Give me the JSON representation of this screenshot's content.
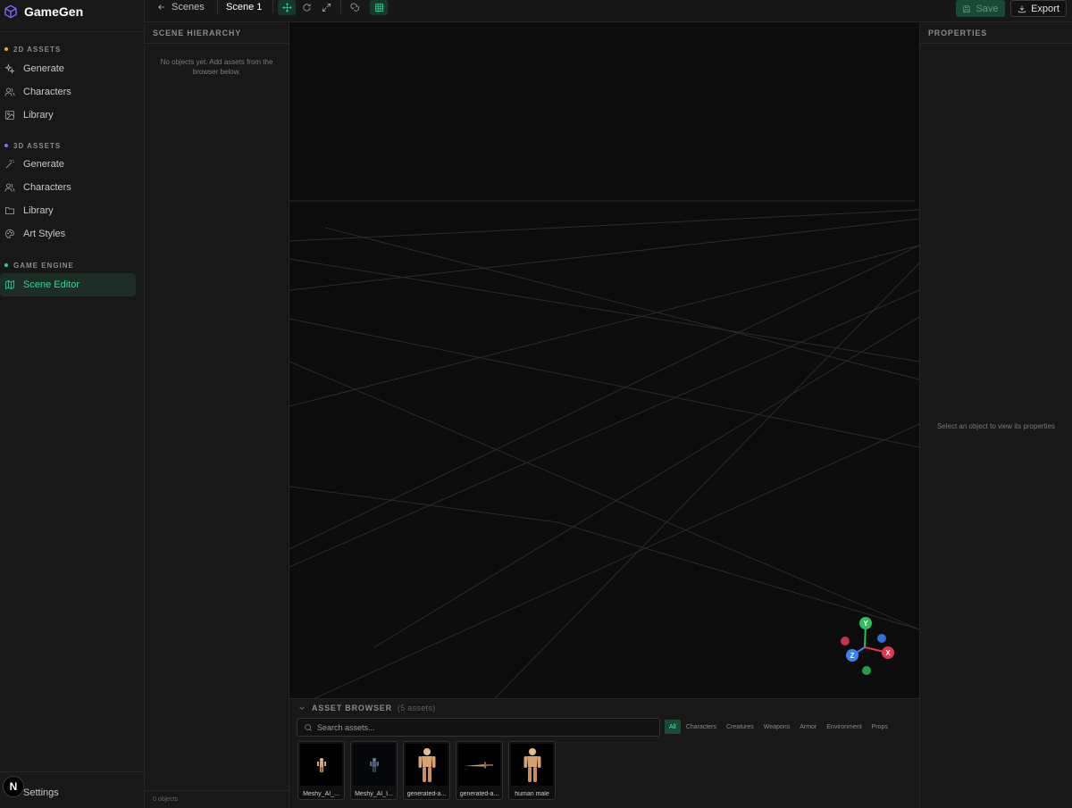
{
  "app": {
    "name": "GameGen"
  },
  "sidebar": {
    "sections": [
      {
        "title": "2D ASSETS",
        "dot_color": "#f5a623",
        "items": [
          {
            "label": "Generate",
            "icon": "sparkles-icon"
          },
          {
            "label": "Characters",
            "icon": "users-icon"
          },
          {
            "label": "Library",
            "icon": "image-icon"
          }
        ]
      },
      {
        "title": "3D ASSETS",
        "dot_color": "#6b7cff",
        "items": [
          {
            "label": "Generate",
            "icon": "magic-wand-icon"
          },
          {
            "label": "Characters",
            "icon": "users-icon"
          },
          {
            "label": "Library",
            "icon": "folder-icon"
          },
          {
            "label": "Art Styles",
            "icon": "palette-icon"
          }
        ]
      },
      {
        "title": "GAME ENGINE",
        "dot_color": "#2fd08f",
        "items": [
          {
            "label": "Scene Editor",
            "icon": "map-icon",
            "active": true
          }
        ]
      }
    ],
    "settings_label": "Settings",
    "avatar_letter": "N"
  },
  "topbar": {
    "back_label": "Scenes",
    "scene_name": "Scene 1",
    "tools": [
      {
        "icon": "move-icon",
        "active": true
      },
      {
        "icon": "rotate-icon",
        "active": false
      },
      {
        "icon": "scale-icon",
        "active": false
      },
      {
        "icon": "magnet-icon",
        "active": false
      },
      {
        "icon": "grid-icon",
        "active": true
      }
    ],
    "save_label": "Save",
    "export_label": "Export"
  },
  "hierarchy": {
    "title": "SCENE HIERARCHY",
    "empty_message": "No objects yet. Add assets from the browser below.",
    "object_count": "0 objects"
  },
  "properties": {
    "title": "PROPERTIES",
    "empty_message": "Select an object to view its properties"
  },
  "gizmo": {
    "x_label": "X",
    "y_label": "Y",
    "z_label": "Z"
  },
  "asset_browser": {
    "title": "ASSET BROWSER",
    "count": "(5 assets)",
    "search_placeholder": "Search assets...",
    "filters": [
      "All",
      "Characters",
      "Creatures",
      "Weapons",
      "Armor",
      "Environment",
      "Props"
    ],
    "active_filter": "All",
    "assets": [
      {
        "name": "Meshy_AI_...",
        "thumb": "small-figure"
      },
      {
        "name": "Meshy_AI_I...",
        "thumb": "armored-figure"
      },
      {
        "name": "generated-a...",
        "thumb": "human-figure"
      },
      {
        "name": "generated-a...",
        "thumb": "sword"
      },
      {
        "name": "human male",
        "thumb": "human-figure"
      }
    ]
  }
}
